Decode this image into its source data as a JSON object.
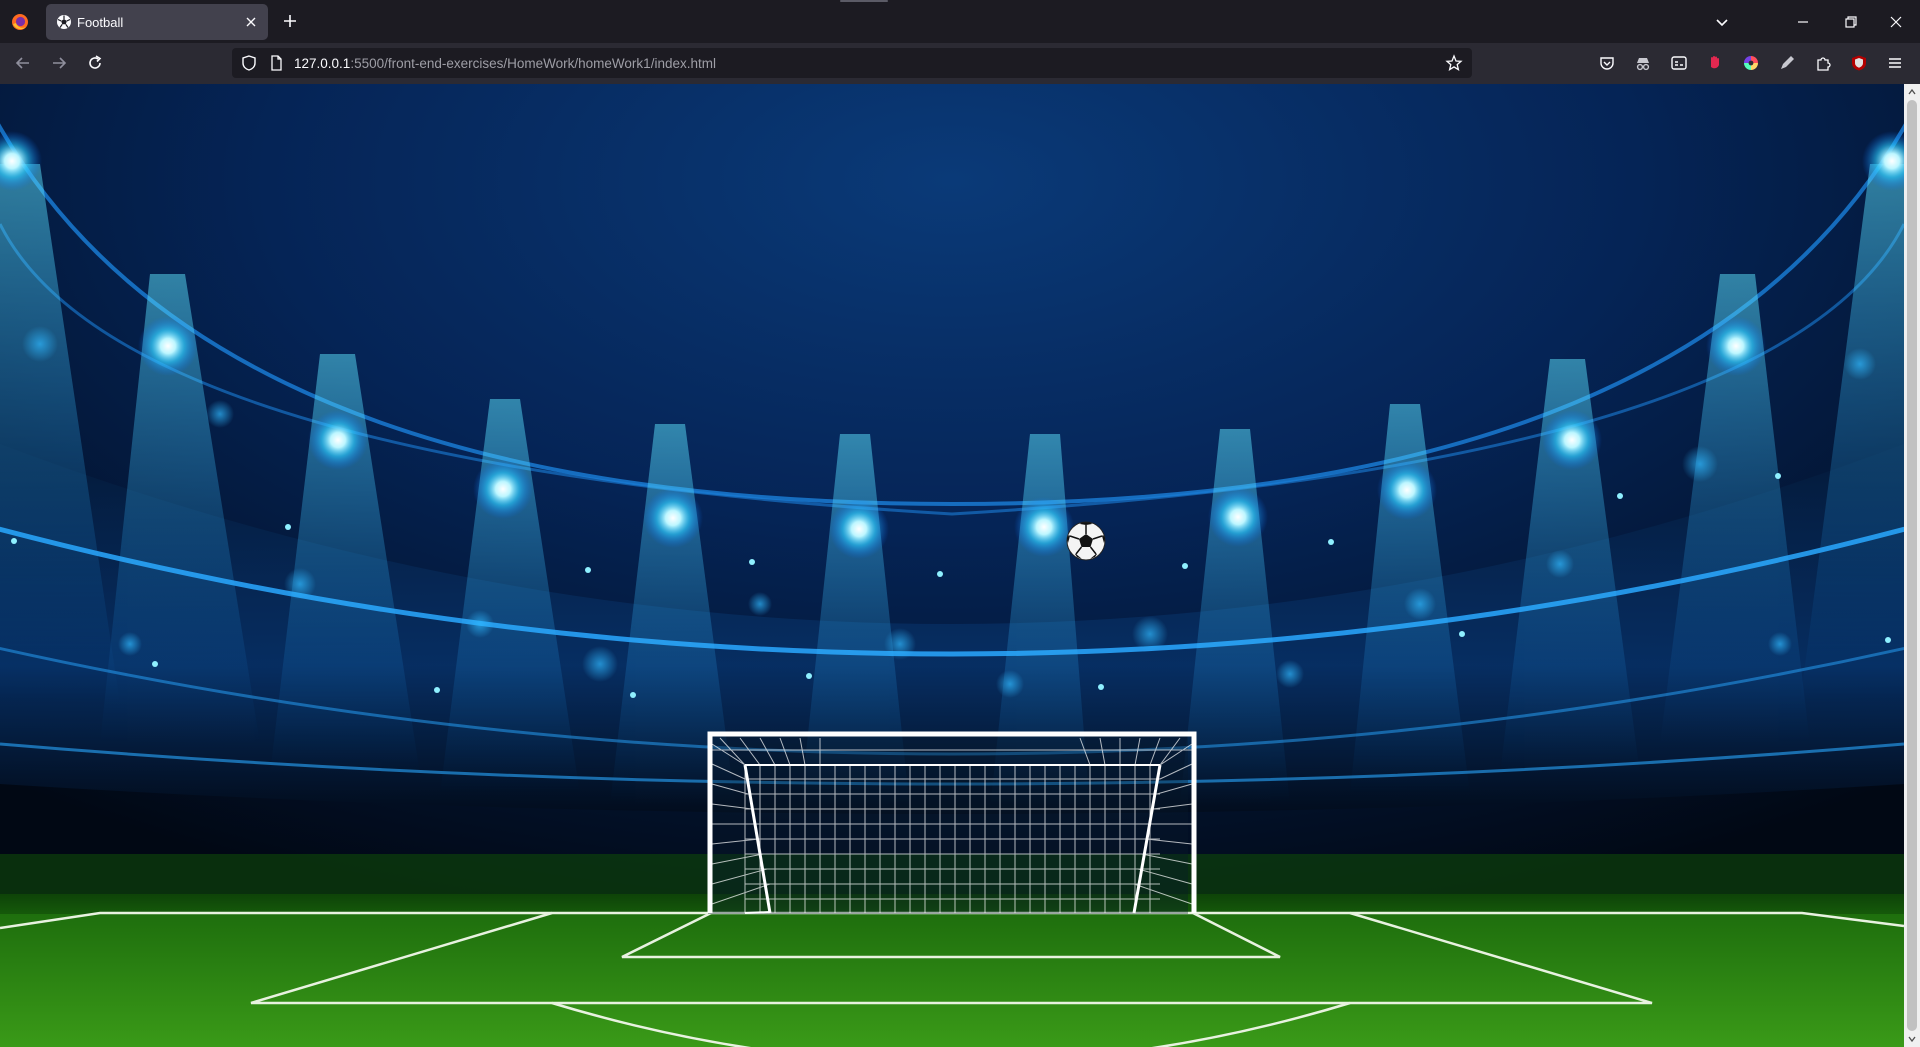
{
  "browser": {
    "tab": {
      "title": "Football",
      "favicon": "soccer-ball-icon"
    },
    "url": {
      "host": "127.0.0.1",
      "rest": ":5500/front-end-exercises/HomeWork/homeWork1/index.html"
    },
    "toolbar_icons": [
      "back-icon",
      "forward-icon",
      "reload-icon"
    ],
    "extension_icons": [
      "pocket-icon",
      "incognito-icon",
      "reader-icon",
      "hand-icon",
      "color-wheel-icon",
      "pen-icon",
      "puzzle-icon",
      "shield-icon",
      "menu-icon"
    ],
    "window_controls": [
      "minimize-icon",
      "restore-icon",
      "close-icon"
    ]
  },
  "page": {
    "scene": "stadium-at-night",
    "elements": [
      "floodlights",
      "goal-net",
      "pitch-markings",
      "soccer-ball"
    ]
  },
  "colors": {
    "tab_bar": "#1c1b22",
    "nav_bar": "#2b2a33",
    "active_tab": "#42414d",
    "sky": "#04152e",
    "light_glow": "#29c8ff",
    "grass": "#2e8a12"
  }
}
